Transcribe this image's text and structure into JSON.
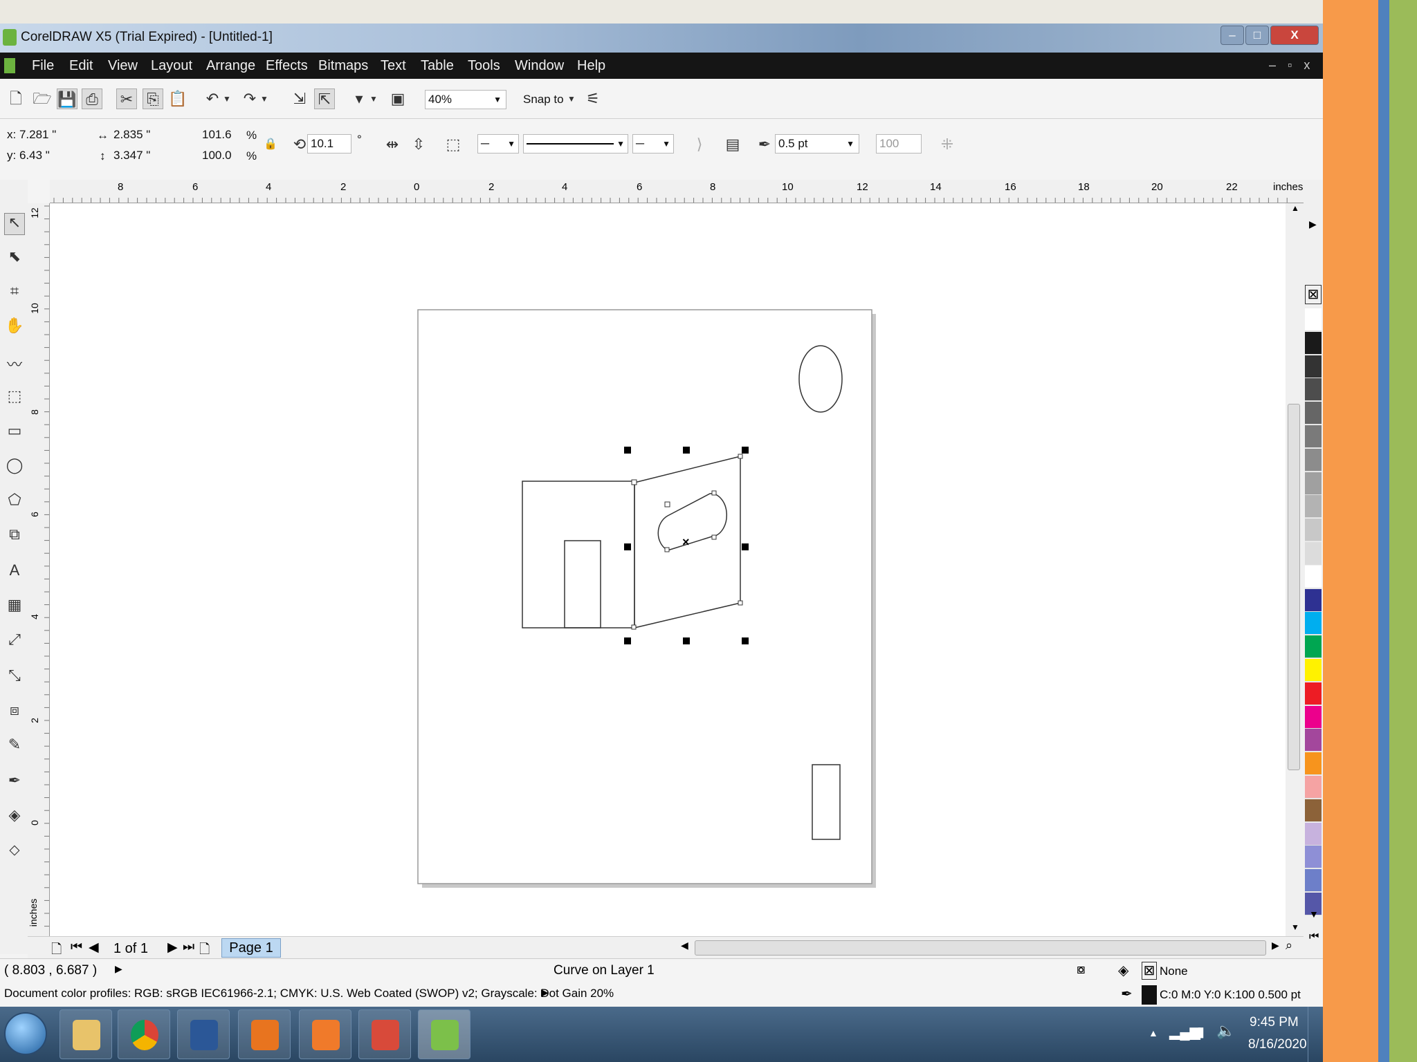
{
  "window": {
    "title": "CorelDRAW X5 (Trial Expired) - [Untitled-1]",
    "min_label": "–",
    "max_label": "□",
    "close_label": "X",
    "doc_controls": "– ▫ x"
  },
  "menu": [
    "File",
    "Edit",
    "View",
    "Layout",
    "Arrange",
    "Effects",
    "Bitmaps",
    "Text",
    "Table",
    "Tools",
    "Window",
    "Help"
  ],
  "toolbar": {
    "zoom": "40%",
    "snap_to": "Snap to"
  },
  "property_bar": {
    "x": "x: 7.281 \"",
    "y": "y: 6.43 \"",
    "width": "2.835 \"",
    "height": "3.347 \"",
    "scale_x": "101.6",
    "scale_y": "100.0",
    "pct": "%",
    "rotation": "10.1",
    "deg": "°",
    "outline_width": "0.5 pt",
    "stretch": "100"
  },
  "ruler": {
    "units": "inches",
    "h_ticks": [
      "8",
      "6",
      "4",
      "2",
      "0",
      "2",
      "4",
      "6",
      "8",
      "10",
      "12",
      "14",
      "16",
      "18",
      "20",
      "22"
    ],
    "v_ticks": [
      "12",
      "10",
      "8",
      "6",
      "4",
      "2",
      "0"
    ]
  },
  "pagebar": {
    "page_count": "1 of 1",
    "page_tab": "Page 1"
  },
  "status": {
    "coords": "( 8.803 , 6.687 )",
    "object_info": "Curve on Layer 1",
    "fill": "None",
    "color_profiles": "Document color profiles: RGB: sRGB IEC61966-2.1; CMYK: U.S. Web Coated (SWOP) v2; Grayscale: Dot Gain 20%",
    "outline": "C:0 M:0 Y:0 K:100  0.500 pt"
  },
  "palette": [
    "#ffffff",
    "#1a1a1a",
    "#333333",
    "#4d4d4d",
    "#666666",
    "#7a7a7a",
    "#8c8c8c",
    "#a0a0a0",
    "#b3b3b3",
    "#c8c8c8",
    "#dcdcdc",
    "#ffffff",
    "#2e3192",
    "#00aeef",
    "#00a651",
    "#fff200",
    "#ed1c24",
    "#ec008c",
    "#a3479c",
    "#f7941d",
    "#f5a3a3",
    "#8c6239",
    "#c7b2de",
    "#8e8fd6",
    "#6d7fc9",
    "#5557a8"
  ],
  "clock": {
    "time": "9:45 PM",
    "date": "8/16/2020"
  },
  "taskbar": [
    "start",
    "explorer",
    "chrome",
    "word",
    "app4",
    "app5",
    "app6",
    "coreldraw"
  ]
}
